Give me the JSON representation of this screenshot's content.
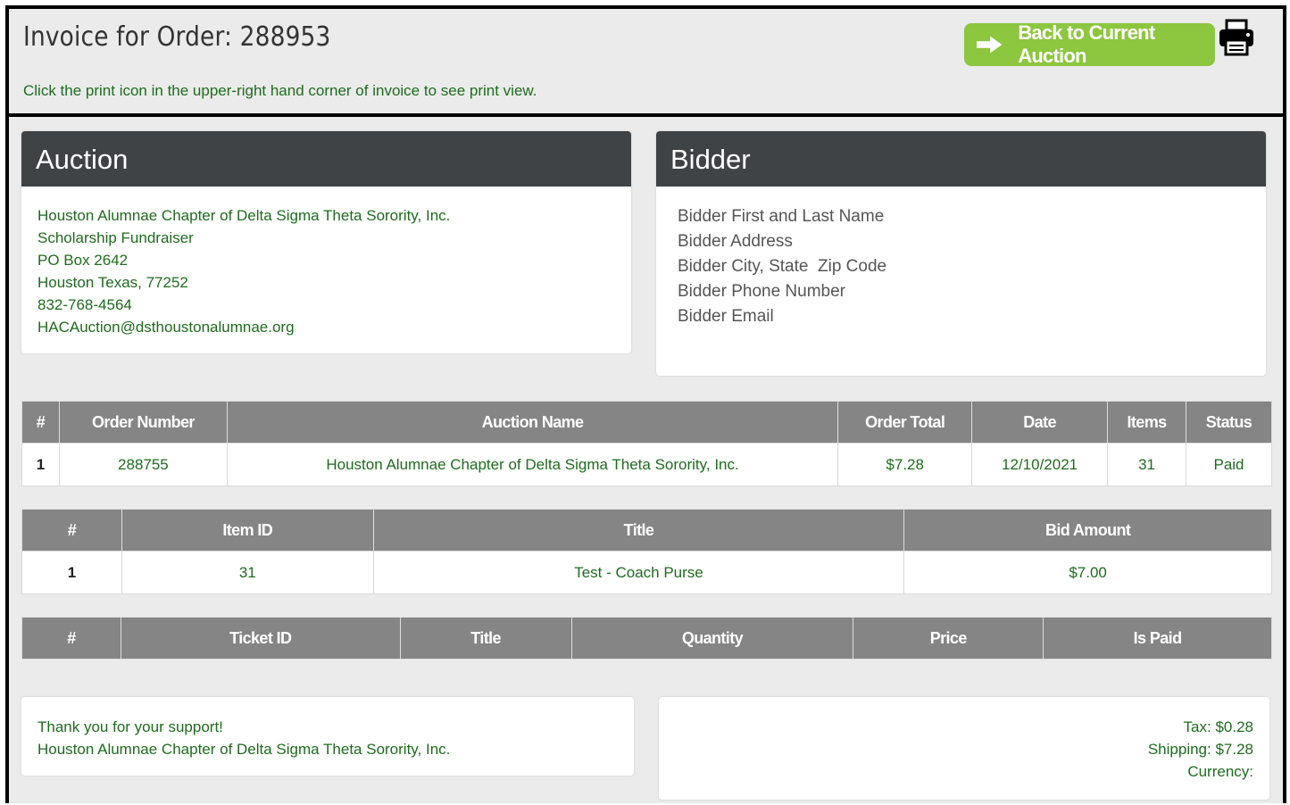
{
  "header": {
    "title": "Invoice for Order: 288953",
    "hint": "Click the print icon in the upper-right hand corner of invoice to see print view.",
    "back_label": "Back to Current Auction",
    "accent_color": "#8dc63f"
  },
  "auction": {
    "heading": "Auction",
    "lines": [
      "Houston Alumnae Chapter of Delta Sigma Theta Sorority, Inc.",
      "Scholarship Fundraiser",
      "PO Box 2642",
      "Houston Texas, 77252",
      "832-768-4564",
      "HACAuction@dsthoustonalumnae.org"
    ]
  },
  "bidder": {
    "heading": "Bidder",
    "lines": [
      "Bidder First and Last Name",
      "Bidder Address",
      "Bidder City, State  Zip Code",
      "Bidder Phone Number",
      "Bidder Email"
    ]
  },
  "orders": {
    "headers": [
      "#",
      "Order Number",
      "Auction Name",
      "Order Total",
      "Date",
      "Items",
      "Status"
    ],
    "rows": [
      [
        "1",
        "288755",
        "Houston Alumnae Chapter of Delta Sigma Theta Sorority, Inc.",
        "$7.28",
        "12/10/2021",
        "31",
        "Paid"
      ]
    ]
  },
  "items": {
    "headers": [
      "#",
      "Item ID",
      "Title",
      "Bid Amount"
    ],
    "rows": [
      [
        "1",
        "31",
        "Test - Coach Purse",
        "$7.00"
      ]
    ]
  },
  "tickets": {
    "headers": [
      "#",
      "Ticket ID",
      "Title",
      "Quantity",
      "Price",
      "Is Paid"
    ],
    "rows": []
  },
  "footer": {
    "thanks_line1": "Thank you for your support!",
    "thanks_line2": "Houston Alumnae Chapter of Delta Sigma Theta Sorority, Inc.",
    "tax": "Tax: $0.28",
    "shipping": "Shipping: $7.28",
    "currency": "Currency:"
  }
}
